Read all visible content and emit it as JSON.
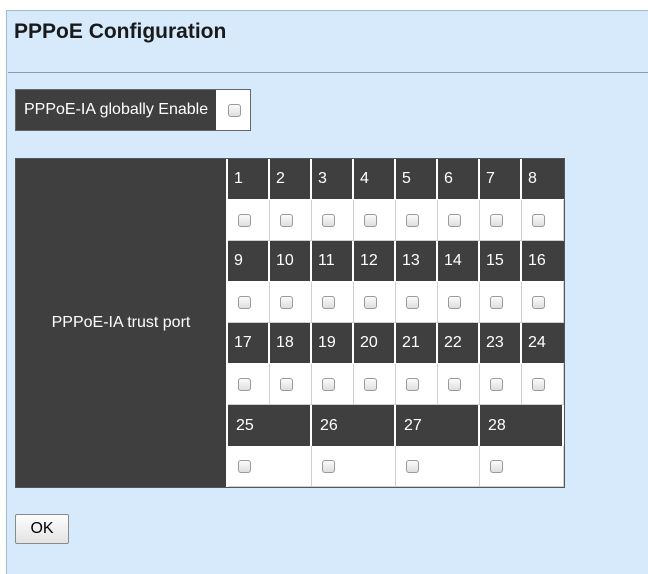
{
  "page": {
    "title": "PPPoE Configuration"
  },
  "global": {
    "label": "PPPoE-IA globally Enable",
    "enabled": false
  },
  "trust": {
    "label": "PPPoE-IA trust port",
    "rows": [
      [
        "1",
        "2",
        "3",
        "4",
        "5",
        "6",
        "7",
        "8"
      ],
      [
        "9",
        "10",
        "11",
        "12",
        "13",
        "14",
        "15",
        "16"
      ],
      [
        "17",
        "18",
        "19",
        "20",
        "21",
        "22",
        "23",
        "24"
      ]
    ],
    "wide_ports": [
      "25",
      "26",
      "27",
      "28"
    ]
  },
  "actions": {
    "ok_label": "OK"
  }
}
